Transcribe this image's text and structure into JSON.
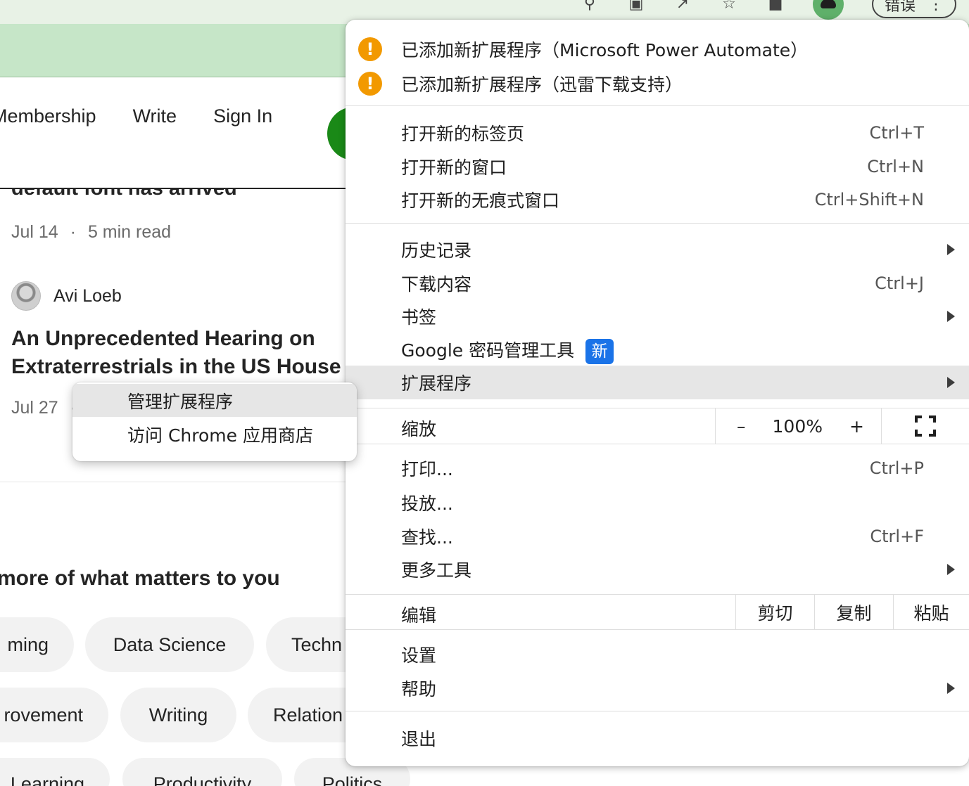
{
  "browser": {
    "profile_error_label": "错误",
    "icons": [
      "search-icon",
      "translate-icon",
      "share-icon",
      "star-icon",
      "extensions-icon"
    ]
  },
  "page": {
    "nav": {
      "membership": "Membership",
      "write": "Write",
      "sign_in": "Sign In"
    },
    "article1": {
      "title_fragment": "default font has arrived",
      "date": "Jul 14",
      "separator": "·",
      "read_time": "5 min read"
    },
    "article2": {
      "author": "Avi Loeb",
      "title": "An Unprecedented Hearing on Extraterrestrials in the US House",
      "date": "Jul 27",
      "separator": "·"
    },
    "recommend_heading": "more of what matters to you",
    "topics": [
      "ming",
      "Data Science",
      "Techn",
      "rovement",
      "Writing",
      "Relation",
      "Learning",
      "Productivity",
      "Politics"
    ]
  },
  "menu": {
    "notifications": [
      "已添加新扩展程序（Microsoft Power Automate）",
      "已添加新扩展程序（迅雷下载支持）"
    ],
    "new_tab": {
      "label": "打开新的标签页",
      "shortcut": "Ctrl+T"
    },
    "new_window": {
      "label": "打开新的窗口",
      "shortcut": "Ctrl+N"
    },
    "incognito": {
      "label": "打开新的无痕式窗口",
      "shortcut": "Ctrl+Shift+N"
    },
    "history": {
      "label": "历史记录"
    },
    "downloads": {
      "label": "下载内容",
      "shortcut": "Ctrl+J"
    },
    "bookmarks": {
      "label": "书签"
    },
    "password_manager": {
      "label": "Google 密码管理工具",
      "badge": "新"
    },
    "extensions": {
      "label": "扩展程序"
    },
    "zoom": {
      "label": "缩放",
      "minus": "–",
      "value": "100%",
      "plus": "+"
    },
    "print": {
      "label": "打印...",
      "shortcut": "Ctrl+P"
    },
    "cast": {
      "label": "投放..."
    },
    "find": {
      "label": "查找...",
      "shortcut": "Ctrl+F"
    },
    "more_tools": {
      "label": "更多工具"
    },
    "edit": {
      "label": "编辑",
      "cut": "剪切",
      "copy": "复制",
      "paste": "粘贴"
    },
    "settings": {
      "label": "设置"
    },
    "help": {
      "label": "帮助"
    },
    "exit": {
      "label": "退出"
    }
  },
  "submenu": {
    "manage_extensions": "管理扩展程序",
    "chrome_web_store": "访问 Chrome 应用商店"
  }
}
